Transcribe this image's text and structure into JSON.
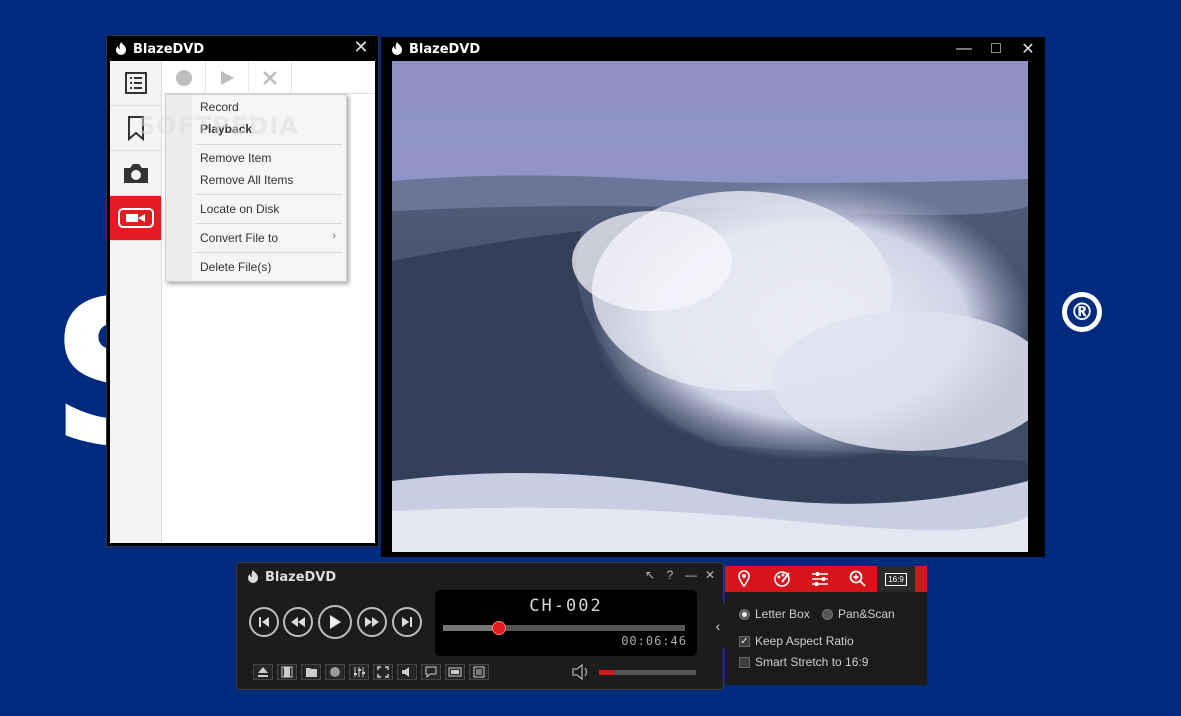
{
  "watermark": {
    "letters": "S        A",
    "registered": "®",
    "softpedia": "SOFTPEDIA"
  },
  "app": {
    "name": "BlazeDVD"
  },
  "playlist": {
    "close": "✕",
    "tabs": [
      {
        "icon": "list-icon"
      },
      {
        "icon": "bookmark-icon"
      },
      {
        "icon": "camera-icon"
      },
      {
        "icon": "video-record-icon",
        "active": true
      }
    ],
    "toolbar": [
      {
        "icon": "record-icon"
      },
      {
        "icon": "play-icon"
      },
      {
        "icon": "delete-icon"
      }
    ]
  },
  "context_menu": {
    "items": [
      "Record",
      "Playback",
      "Remove Item",
      "Remove All Items",
      "Locate on Disk",
      "Convert File to",
      "Delete File(s)"
    ],
    "submenu_arrow": "›"
  },
  "video_window": {
    "minimize": "—",
    "maximize": "□",
    "close": "✕"
  },
  "control_bar": {
    "tools": [
      "↖",
      "?",
      "—",
      "✕"
    ],
    "chapter": "CH-002",
    "time": "00:06:46",
    "progress": 0.23,
    "volume": 0.15,
    "buttons": [
      "prev-chapter-icon",
      "rewind-icon",
      "play-icon",
      "fast-forward-icon",
      "next-chapter-icon"
    ],
    "bottom_buttons": [
      "eject-icon",
      "film-icon",
      "open-folder-icon",
      "record-icon",
      "equalizer-icon",
      "fullscreen-icon",
      "speaker-icon",
      "subtitle-icon",
      "aspect-icon",
      "playlist-icon"
    ],
    "expand": "‹"
  },
  "aspect_panel": {
    "tabs": [
      "location-icon",
      "color-palette-icon",
      "adjust-icon",
      "zoom-icon",
      "aspect-16-9-icon"
    ],
    "aspect_label": "16:9",
    "letter_box": "Letter Box",
    "pan_scan": "Pan&Scan",
    "keep_aspect": "Keep Aspect Ratio",
    "smart_stretch": "Smart Stretch to 16:9",
    "letter_box_selected": true,
    "keep_aspect_checked": true,
    "smart_stretch_checked": false
  },
  "colors": {
    "accent": "#d5141b",
    "background": "#002a7e"
  }
}
